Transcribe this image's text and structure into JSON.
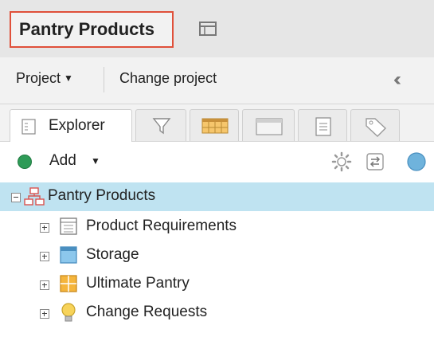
{
  "header": {
    "title": "Pantry Products"
  },
  "projectbar": {
    "project_menu": "Project",
    "change_project": "Change project"
  },
  "tabs": [
    {
      "label": "Explorer",
      "icon": "explorer-icon",
      "active": true
    },
    {
      "icon": "filter-icon"
    },
    {
      "icon": "grid-icon"
    },
    {
      "icon": "window-icon"
    },
    {
      "icon": "document-icon"
    },
    {
      "icon": "tag-icon"
    }
  ],
  "toolbar": {
    "add_label": "Add"
  },
  "tree": {
    "root": {
      "label": "Pantry Products",
      "icon": "project-icon"
    },
    "children": [
      {
        "label": "Product Requirements",
        "icon": "requirements-icon"
      },
      {
        "label": "Storage",
        "icon": "storage-icon"
      },
      {
        "label": "Ultimate Pantry",
        "icon": "grid-folder-icon"
      },
      {
        "label": "Change Requests",
        "icon": "lightbulb-icon"
      }
    ]
  },
  "colors": {
    "highlight_border": "#e0503a",
    "selection": "#bfe3f1",
    "add_green": "#2e9b57"
  }
}
